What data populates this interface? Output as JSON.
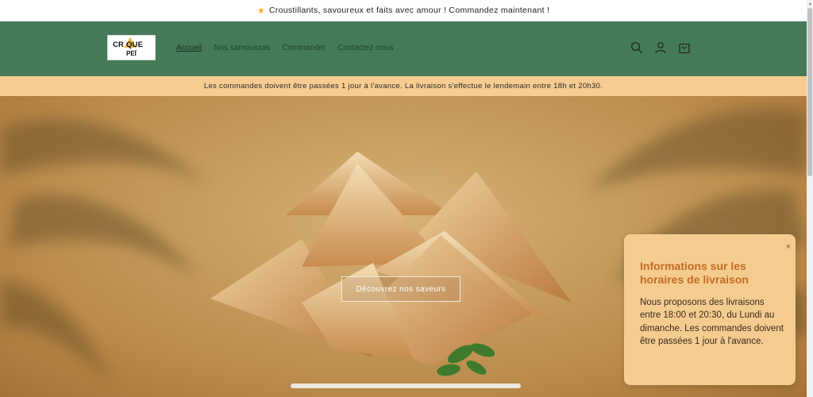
{
  "announcement": {
    "text": "Croustillants, savoureux et faits avec amour ! Commandez maintenant !"
  },
  "header": {
    "logo_line1": "CR QUE",
    "logo_line2": "PEÏ",
    "nav": [
      "Accueil",
      "Nos samoussas",
      "Commander",
      "Contactez-nous"
    ],
    "icons": [
      "search-icon",
      "account-icon",
      "cart-icon"
    ]
  },
  "notice": {
    "text": "Les commandes doivent être passées 1 jour à l'avance. La livraison s'effectue le lendemain entre 18h et 20h30."
  },
  "hero": {
    "button_label": "Découvrez nos saveurs"
  },
  "popup": {
    "title": "Informations sur les horaires de livraison",
    "body": "Nous proposons des livraisons entre 18:00 et 20:30, du Lundi au dimanche. Les commandes doivent être passées 1 jour à l'avance.",
    "close": "×"
  },
  "colors": {
    "header": "#447a58",
    "notice": "#f6cc90",
    "popup_title": "#c36b23"
  }
}
